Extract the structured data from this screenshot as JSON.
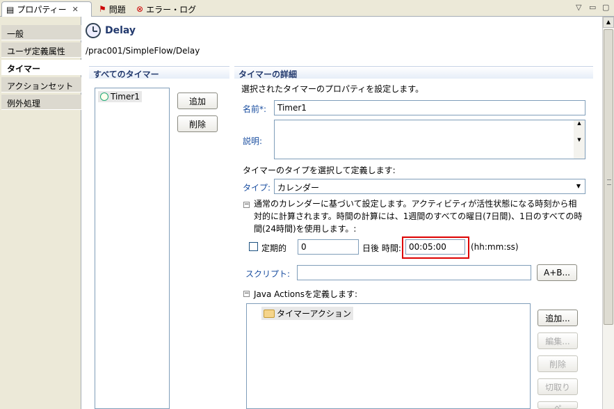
{
  "tabs": [
    {
      "label": "プロパティー"
    },
    {
      "label": "問題"
    },
    {
      "label": "エラー・ログ"
    }
  ],
  "categories": [
    "一般",
    "ユーザ定義属性",
    "タイマー",
    "アクションセット",
    "例外処理"
  ],
  "header": {
    "title": "Delay",
    "path": "/prac001/SimpleFlow/Delay"
  },
  "all_timers": {
    "title": "すべてのタイマー",
    "items": [
      "Timer1"
    ],
    "add_label": "追加",
    "delete_label": "削除"
  },
  "details": {
    "title": "タイマーの詳細",
    "intro": "選択されたタイマーのプロパティを設定します。",
    "name_label": "名前*:",
    "name_value": "Timer1",
    "desc_label": "説明:",
    "type_intro": "タイマーのタイプを選択して定義します:",
    "type_label": "タイプ:",
    "type_value": "カレンダー",
    "calendar_desc_1": "通常のカレンダーに基づいて設定します。アクティビティが活性状態になる時刻から相",
    "calendar_desc_2": "対的に計算されます。時間の計算には、1週間のすべての曜日(7日間)、1日のすべての時",
    "calendar_desc_3": "間(24時間)を使用します。:",
    "periodic_label": "定期的",
    "days_value": "0",
    "days_after_label": "日後 時間:",
    "time_value": "00:05:00",
    "time_format": "(hh:mm:ss)",
    "script_label": "スクリプト:",
    "script_value": "",
    "script_btn": "A+B...",
    "java_actions_label": "Java Actionsを定義します:",
    "action_item": "タイマーアクション",
    "btn_add": "追加...",
    "btn_edit": "編集...",
    "btn_delete": "削除",
    "btn_cut": "切取り",
    "btn_paste": "ペ"
  }
}
